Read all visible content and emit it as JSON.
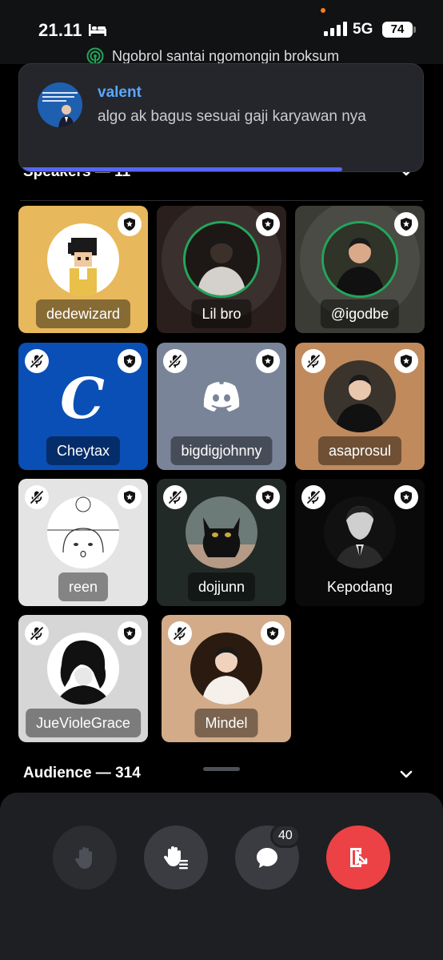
{
  "status_bar": {
    "time": "21.11",
    "network": "5G",
    "battery": "74"
  },
  "stage": {
    "title": "Ngobrol santai ngomongin broksum",
    "accent": "#23a55a"
  },
  "notification": {
    "author": "valent",
    "message": "algo ak bagus sesuai gaji karyawan nya",
    "progress": 0.8
  },
  "speakers": {
    "header": "Speakers — 11",
    "tiles": [
      {
        "name": "dedewizard",
        "bg": "#e8b85c",
        "muted": false,
        "moderator": true,
        "speaking": false,
        "avatar": "pixel-art-icon"
      },
      {
        "name": "Lil bro",
        "bg": "#2a1f1d",
        "muted": false,
        "moderator": true,
        "speaking": true,
        "avatar": "photo"
      },
      {
        "name": "@igodbe",
        "bg": "#3b3c35",
        "muted": false,
        "moderator": true,
        "speaking": true,
        "avatar": "photo"
      },
      {
        "name": "Cheytax",
        "bg": "#0a4fb5",
        "muted": true,
        "moderator": true,
        "speaking": false,
        "avatar": "c-logo-icon"
      },
      {
        "name": "bigdigjohnny",
        "bg": "#7a8499",
        "muted": true,
        "moderator": true,
        "speaking": false,
        "avatar": "discord-icon"
      },
      {
        "name": "asaprosul",
        "bg": "#c08a5c",
        "muted": true,
        "moderator": true,
        "speaking": false,
        "avatar": "photo"
      },
      {
        "name": "reen",
        "bg": "#e4e4e4",
        "muted": true,
        "moderator": true,
        "speaking": false,
        "avatar": "sketch-face-icon"
      },
      {
        "name": "dojjunn",
        "bg": "#222a27",
        "muted": true,
        "moderator": true,
        "speaking": false,
        "avatar": "black-cat-photo"
      },
      {
        "name": "Kepodang",
        "bg": "#0a0a0a",
        "muted": true,
        "moderator": true,
        "speaking": false,
        "avatar": "man-portrait-icon"
      },
      {
        "name": "JueVioleGrace",
        "bg": "#d6d6d6",
        "muted": true,
        "moderator": true,
        "speaking": false,
        "avatar": "anime-figure-icon"
      },
      {
        "name": "Mindel",
        "bg": "#d3ab88",
        "muted": true,
        "moderator": true,
        "speaking": false,
        "avatar": "photo"
      }
    ]
  },
  "audience": {
    "header": "Audience — 314"
  },
  "controls": {
    "chat_count": "40",
    "leave_color": "#ed4245"
  }
}
